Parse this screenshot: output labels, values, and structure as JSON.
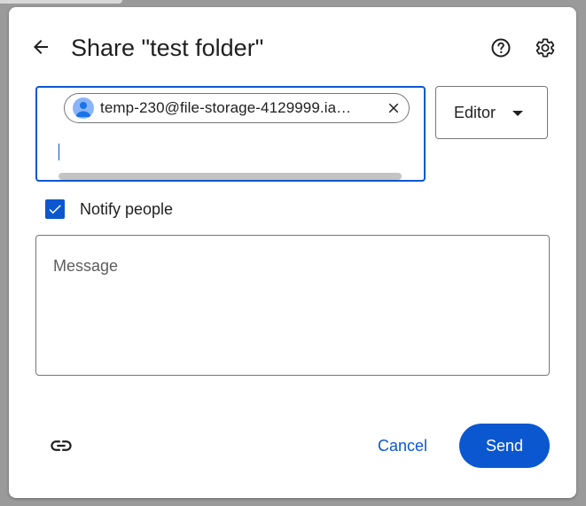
{
  "dialog": {
    "title": "Share \"test folder\""
  },
  "recipients": [
    {
      "label": "temp-230@file-storage-4129999.ia…"
    }
  ],
  "role": {
    "selected": "Editor"
  },
  "notify": {
    "label": "Notify people",
    "checked": true
  },
  "message": {
    "placeholder": "Message"
  },
  "actions": {
    "cancel": "Cancel",
    "send": "Send"
  },
  "colors": {
    "accent": "#0b57d0",
    "avatar": "#8ab4f8"
  },
  "icons": {
    "back": "arrow-back-icon",
    "help": "help-icon",
    "settings": "gear-icon",
    "remove": "close-icon",
    "dropdown": "arrow-drop-down-icon",
    "check": "check-icon",
    "link": "link-icon",
    "avatar": "person-icon"
  }
}
